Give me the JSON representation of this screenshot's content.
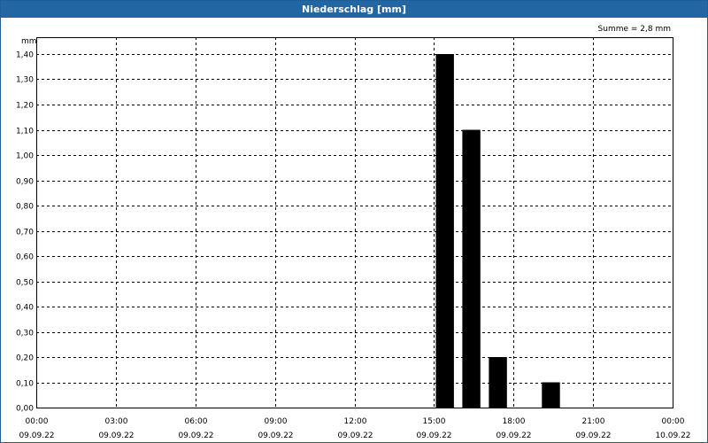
{
  "window": {
    "title": "Niederschlag [mm]"
  },
  "chart_data": {
    "type": "bar",
    "title": "Niederschlag [mm]",
    "ylabel": "mm",
    "annotation": "Summe = 2,8 mm",
    "ylim": [
      0,
      1.4
    ],
    "y_ticks": [
      "0,00",
      "0,10",
      "0,20",
      "0,30",
      "0,40",
      "0,50",
      "0,60",
      "0,70",
      "0,80",
      "0,90",
      "1,00",
      "1,10",
      "1,20",
      "1,30",
      "1,40"
    ],
    "x_ticks": [
      {
        "time": "00:00",
        "date": "09.09.22"
      },
      {
        "time": "03:00",
        "date": "09.09.22"
      },
      {
        "time": "06:00",
        "date": "09.09.22"
      },
      {
        "time": "09:00",
        "date": "09.09.22"
      },
      {
        "time": "12:00",
        "date": "09.09.22"
      },
      {
        "time": "15:00",
        "date": "09.09.22"
      },
      {
        "time": "18:00",
        "date": "09.09.22"
      },
      {
        "time": "21:00",
        "date": "09.09.22"
      },
      {
        "time": "00:00",
        "date": "10.09.22"
      }
    ],
    "x_range_hours": [
      0,
      24
    ],
    "bars": [
      {
        "hour_start": 15,
        "value": 1.4
      },
      {
        "hour_start": 16,
        "value": 1.1
      },
      {
        "hour_start": 17,
        "value": 0.2
      },
      {
        "hour_start": 19,
        "value": 0.1
      }
    ],
    "grid": true,
    "colors": {
      "bar": "#000000",
      "titlebar": "#2266a3"
    }
  }
}
